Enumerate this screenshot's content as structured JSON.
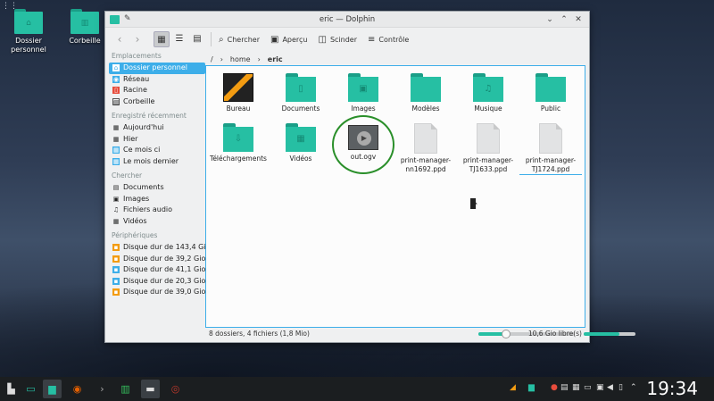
{
  "desktop": {
    "icons": [
      {
        "label_line1": "Dossier",
        "label_line2": "personnel"
      },
      {
        "label_line1": "Corbeille",
        "label_line2": ""
      }
    ]
  },
  "window": {
    "title": "eric — Dolphin"
  },
  "toolbar": {
    "search_label": "Chercher",
    "preview_label": "Aperçu",
    "split_label": "Scinder",
    "control_label": "Contrôle"
  },
  "sidebar": {
    "sections": [
      {
        "title": "Emplacements",
        "items": [
          "Dossier personnel",
          "Réseau",
          "Racine",
          "Corbeille"
        ]
      },
      {
        "title": "Enregistré récemment",
        "items": [
          "Aujourd'hui",
          "Hier",
          "Ce mois ci",
          "Le mois dernier"
        ]
      },
      {
        "title": "Chercher",
        "items": [
          "Documents",
          "Images",
          "Fichiers audio",
          "Vidéos"
        ]
      },
      {
        "title": "Périphériques",
        "items": [
          "Disque dur de 143,4 Gio",
          "Disque dur de 39,2 Gio",
          "Disque dur de 41,1 Gio",
          "Disque dur de 20,3 Gio",
          "Disque dur de 39,0 Gio"
        ]
      }
    ]
  },
  "breadcrumb": {
    "root": "/",
    "home": "home",
    "current": "eric"
  },
  "files": [
    {
      "name": "Bureau",
      "kind": "bureau"
    },
    {
      "name": "Documents",
      "kind": "folder",
      "glyph": "▯"
    },
    {
      "name": "Images",
      "kind": "folder",
      "glyph": "▣"
    },
    {
      "name": "Modèles",
      "kind": "folder",
      "glyph": ""
    },
    {
      "name": "Musique",
      "kind": "folder",
      "glyph": "♫"
    },
    {
      "name": "Public",
      "kind": "folder",
      "glyph": ""
    },
    {
      "name": "Téléchargements",
      "kind": "folder",
      "glyph": "⇩"
    },
    {
      "name": "Vidéos",
      "kind": "folder",
      "glyph": "▦"
    },
    {
      "name": "out.ogv",
      "kind": "video"
    },
    {
      "name": "print-manager-nn1692.ppd",
      "kind": "file"
    },
    {
      "name": "print-manager-TJ1633.ppd",
      "kind": "file"
    },
    {
      "name": "print-manager-TJ1724.ppd",
      "kind": "file"
    }
  ],
  "status": {
    "summary": "8 dossiers, 4 fichiers (1,8 Mio)",
    "free_space": "10,6 Gio libre(s)"
  },
  "taskbar": {
    "clock": "19:34"
  },
  "colors": {
    "accent": "#3daee9",
    "folder": "#26bfa3",
    "highlight_circle": "#2a8f2a"
  }
}
